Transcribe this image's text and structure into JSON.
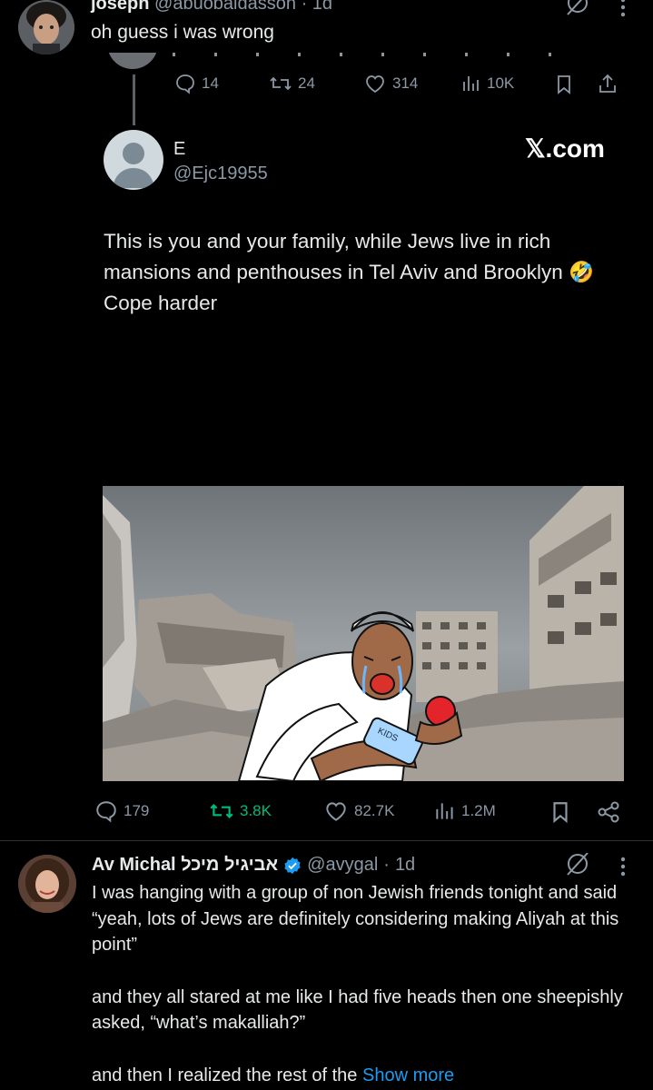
{
  "tweet1": {
    "name": "joseph",
    "handle": "@abuobaidasson",
    "time": "1d",
    "text": "oh guess i was wrong"
  },
  "tweet1_stats": {
    "replies": "14",
    "retweets": "24",
    "likes": "314",
    "views": "10K"
  },
  "quoted": {
    "name": "E",
    "handle": "@Ejc19955",
    "watermark": "𝕏.com",
    "text_before_emoji": "This is you and your family, while Jews live in rich mansions and penthouses in Tel Aviv and Brooklyn",
    "emoji": "🤣",
    "text_after_emoji": "Cope harder",
    "image_caption": "KIDS"
  },
  "quoted_stats": {
    "replies": "179",
    "retweets": "3.8K",
    "likes": "82.7K",
    "views": "1.2M"
  },
  "tweet2": {
    "name": "Av Michal אביגיל מיכל",
    "handle": "@avygal",
    "time": "1d",
    "para1": "I was hanging with a group of non Jewish friends tonight and said “yeah, lots of Jews are definitely considering making Aliyah at this point”",
    "para2": "and they all stared at me like I had five heads then one sheepishly asked, “what’s makalliah?”",
    "para3": "and then I realized the rest of the",
    "show_more": "Show more"
  },
  "colors": {
    "background": "#000000",
    "text": "#e7e9ea",
    "muted": "#8b98a5",
    "link": "#1d9bf0",
    "retweet_active": "#00ba7c",
    "verified": "#1d9bf0"
  },
  "icons": [
    "grok-icon",
    "more-icon",
    "reply-icon",
    "retweet-icon",
    "like-icon",
    "views-icon",
    "bookmark-icon",
    "share-icon",
    "verified-icon"
  ]
}
